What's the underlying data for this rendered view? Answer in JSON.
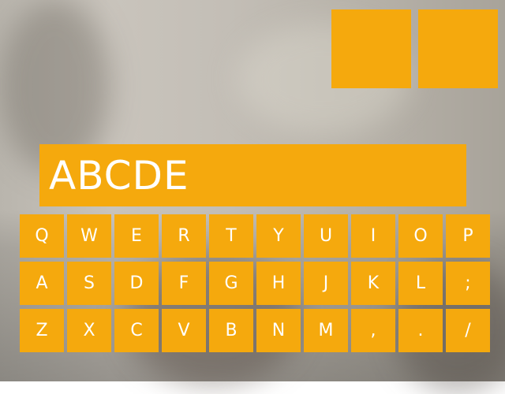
{
  "display": {
    "text": "ABCDE"
  },
  "keyboard": {
    "rows": [
      [
        "Q",
        "W",
        "E",
        "R",
        "T",
        "Y",
        "U",
        "I",
        "O",
        "P"
      ],
      [
        "A",
        "S",
        "D",
        "F",
        "G",
        "H",
        "J",
        "K",
        "L",
        ";"
      ],
      [
        "Z",
        "X",
        "C",
        "V",
        "B",
        "N",
        "M",
        ",",
        ".",
        "/"
      ]
    ]
  },
  "colors": {
    "accent": "#f5a90d",
    "key_text": "#ffffff"
  }
}
